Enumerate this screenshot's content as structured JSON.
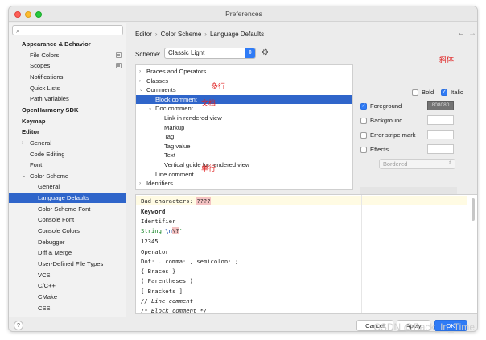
{
  "window": {
    "title": "Preferences"
  },
  "search": {
    "placeholder": "",
    "icon": "search-icon"
  },
  "sidebar": {
    "items": [
      {
        "label": "Appearance & Behavior",
        "bold": true,
        "expanded": true,
        "level": 0
      },
      {
        "label": "File Colors",
        "level": 1,
        "badge": true
      },
      {
        "label": "Scopes",
        "level": 1,
        "badge": true
      },
      {
        "label": "Notifications",
        "level": 1
      },
      {
        "label": "Quick Lists",
        "level": 1
      },
      {
        "label": "Path Variables",
        "level": 1
      },
      {
        "label": "OpenHarmony SDK",
        "bold": true,
        "level": 0
      },
      {
        "label": "Keymap",
        "bold": true,
        "level": 0
      },
      {
        "label": "Editor",
        "bold": true,
        "expanded": true,
        "level": 0
      },
      {
        "label": "General",
        "level": 1,
        "collapsed": true
      },
      {
        "label": "Code Editing",
        "level": 1
      },
      {
        "label": "Font",
        "level": 1
      },
      {
        "label": "Color Scheme",
        "level": 1,
        "expanded": true
      },
      {
        "label": "General",
        "level": 2
      },
      {
        "label": "Language Defaults",
        "level": 2,
        "selected": true
      },
      {
        "label": "Color Scheme Font",
        "level": 2
      },
      {
        "label": "Console Font",
        "level": 2
      },
      {
        "label": "Console Colors",
        "level": 2
      },
      {
        "label": "Debugger",
        "level": 2
      },
      {
        "label": "Diff & Merge",
        "level": 2
      },
      {
        "label": "User-Defined File Types",
        "level": 2
      },
      {
        "label": "VCS",
        "level": 2
      },
      {
        "label": "C/C++",
        "level": 2
      },
      {
        "label": "CMake",
        "level": 2
      },
      {
        "label": "CSS",
        "level": 2
      }
    ]
  },
  "breadcrumb": {
    "a": "Editor",
    "b": "Color Scheme",
    "c": "Language Defaults",
    "sep": "›"
  },
  "nav": {
    "back": "←",
    "forward": "→"
  },
  "scheme": {
    "label": "Scheme:",
    "value": "Classic Light",
    "gear_icon": "gear-icon"
  },
  "attribute_tree": [
    {
      "label": "Braces and Operators",
      "level": 0,
      "arrow": "›"
    },
    {
      "label": "Classes",
      "level": 0,
      "arrow": "›"
    },
    {
      "label": "Comments",
      "level": 0,
      "arrow": "⌄"
    },
    {
      "label": "Block comment",
      "level": 1,
      "selected": true
    },
    {
      "label": "Doc comment",
      "level": 1,
      "arrow": "⌄"
    },
    {
      "label": "Link in rendered view",
      "level": 2
    },
    {
      "label": "Markup",
      "level": 2
    },
    {
      "label": "Tag",
      "level": 2
    },
    {
      "label": "Tag value",
      "level": 2
    },
    {
      "label": "Text",
      "level": 2
    },
    {
      "label": "Vertical guide for rendered view",
      "level": 2
    },
    {
      "label": "Line comment",
      "level": 1
    },
    {
      "label": "Identifiers",
      "level": 0,
      "arrow": "›"
    }
  ],
  "properties": {
    "bold": {
      "label": "Bold",
      "checked": false
    },
    "italic": {
      "label": "Italic",
      "checked": true
    },
    "foreground": {
      "label": "Foreground",
      "checked": true,
      "value": "808080"
    },
    "background": {
      "label": "Background",
      "checked": false
    },
    "error_stripe": {
      "label": "Error stripe mark",
      "checked": false
    },
    "effects": {
      "label": "Effects",
      "checked": false,
      "value": "Bordered"
    }
  },
  "preview": {
    "lines": {
      "bad_label": "Bad characters: ",
      "bad_value": "????",
      "keyword": "Keyword",
      "identifier": "Identifier",
      "string_a": " String ",
      "string_esc": "\\n",
      "string_bad": "\\?",
      "string_end": "'",
      "number": "12345",
      "operator": "Operator",
      "dot": "Dot: . comma: , semicolon: ;",
      "braces": "{ Braces }",
      "parens": "( Parentheses )",
      "brackets": "[ Brackets ]",
      "line_comment": "// Line comment",
      "block_comment": "/* Block comment */"
    }
  },
  "footer": {
    "help": "?",
    "cancel": "Cancel",
    "apply": "Apply",
    "ok": "OK"
  },
  "annotations": {
    "italic_note": "斜体",
    "block_note": "多行",
    "doc_note": "文档",
    "line_note": "单行"
  },
  "watermark": "CSDN @Back_In_Time",
  "colors": {
    "selection": "#2f65ca",
    "accent": "#2f7bf6",
    "annotation": "#e02020",
    "foreground_swatch": "#737373",
    "keyword": "#0c2f9a",
    "number": "#1750eb"
  }
}
